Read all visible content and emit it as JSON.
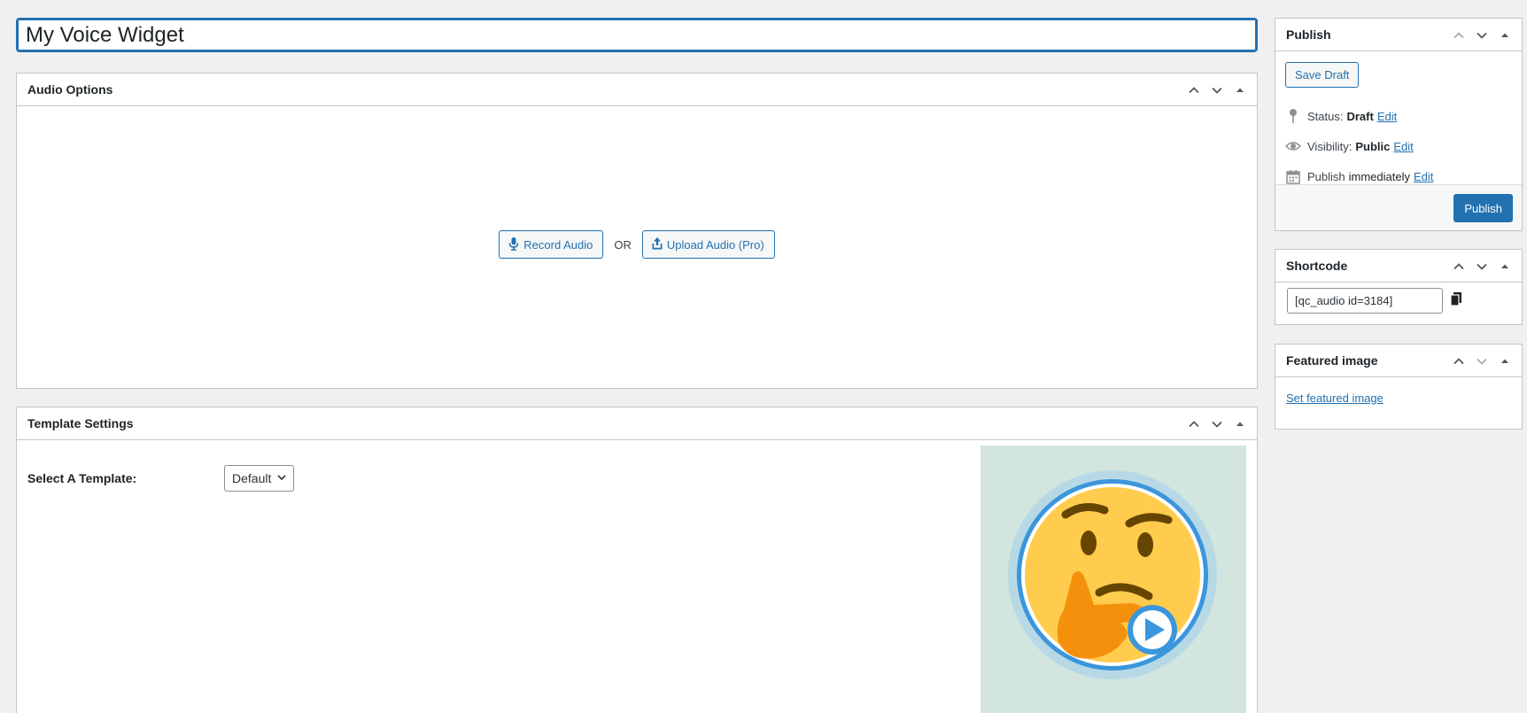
{
  "title_field": {
    "value": "My Voice Widget"
  },
  "audio_options": {
    "heading": "Audio Options",
    "record_label": "Record Audio",
    "or_text": "OR",
    "upload_label": "Upload Audio (Pro)"
  },
  "template_settings": {
    "heading": "Template Settings",
    "select_label": "Select A Template:",
    "selected_value": "Default"
  },
  "publish": {
    "heading": "Publish",
    "save_draft": "Save Draft",
    "status_label": "Status:",
    "status_value": "Draft",
    "visibility_label": "Visibility:",
    "visibility_value": "Public",
    "publish_label": "Publish",
    "publish_value": "immediately",
    "edit_label": "Edit",
    "publish_button": "Publish"
  },
  "shortcode": {
    "heading": "Shortcode",
    "value": "[qc_audio id=3184]"
  },
  "featured_image": {
    "heading": "Featured image",
    "link": "Set featured image"
  },
  "colors": {
    "accent": "#2271b1",
    "background": "#f0f0f1",
    "preview_bg": "#d2e5df",
    "emoji_face": "#ffcc4d",
    "emoji_ring": "#3b96dc"
  },
  "icons": {
    "record": "microphone-icon",
    "upload": "upload-icon",
    "status": "pin-icon",
    "visibility": "eye-icon",
    "schedule": "calendar-icon",
    "copy": "copy-icon",
    "preview": "thinking-face-play-icon"
  }
}
